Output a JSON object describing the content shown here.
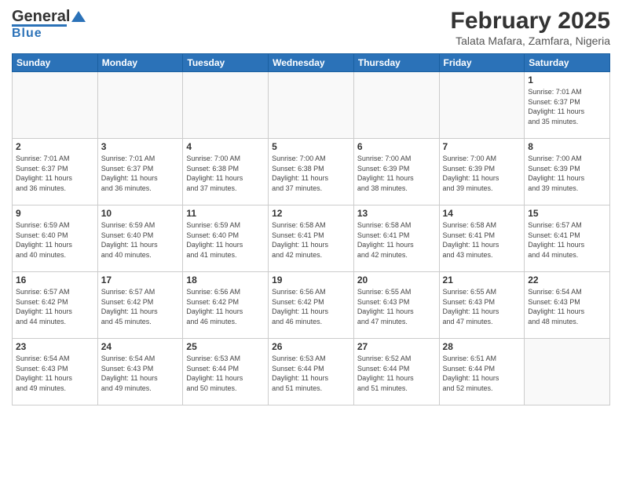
{
  "header": {
    "logo_general": "General",
    "logo_blue": "Blue",
    "month_title": "February 2025",
    "location": "Talata Mafara, Zamfara, Nigeria"
  },
  "days_of_week": [
    "Sunday",
    "Monday",
    "Tuesday",
    "Wednesday",
    "Thursday",
    "Friday",
    "Saturday"
  ],
  "weeks": [
    [
      {
        "day": "",
        "info": ""
      },
      {
        "day": "",
        "info": ""
      },
      {
        "day": "",
        "info": ""
      },
      {
        "day": "",
        "info": ""
      },
      {
        "day": "",
        "info": ""
      },
      {
        "day": "",
        "info": ""
      },
      {
        "day": "1",
        "info": "Sunrise: 7:01 AM\nSunset: 6:37 PM\nDaylight: 11 hours\nand 35 minutes."
      }
    ],
    [
      {
        "day": "2",
        "info": "Sunrise: 7:01 AM\nSunset: 6:37 PM\nDaylight: 11 hours\nand 36 minutes."
      },
      {
        "day": "3",
        "info": "Sunrise: 7:01 AM\nSunset: 6:37 PM\nDaylight: 11 hours\nand 36 minutes."
      },
      {
        "day": "4",
        "info": "Sunrise: 7:00 AM\nSunset: 6:38 PM\nDaylight: 11 hours\nand 37 minutes."
      },
      {
        "day": "5",
        "info": "Sunrise: 7:00 AM\nSunset: 6:38 PM\nDaylight: 11 hours\nand 37 minutes."
      },
      {
        "day": "6",
        "info": "Sunrise: 7:00 AM\nSunset: 6:39 PM\nDaylight: 11 hours\nand 38 minutes."
      },
      {
        "day": "7",
        "info": "Sunrise: 7:00 AM\nSunset: 6:39 PM\nDaylight: 11 hours\nand 39 minutes."
      },
      {
        "day": "8",
        "info": "Sunrise: 7:00 AM\nSunset: 6:39 PM\nDaylight: 11 hours\nand 39 minutes."
      }
    ],
    [
      {
        "day": "9",
        "info": "Sunrise: 6:59 AM\nSunset: 6:40 PM\nDaylight: 11 hours\nand 40 minutes."
      },
      {
        "day": "10",
        "info": "Sunrise: 6:59 AM\nSunset: 6:40 PM\nDaylight: 11 hours\nand 40 minutes."
      },
      {
        "day": "11",
        "info": "Sunrise: 6:59 AM\nSunset: 6:40 PM\nDaylight: 11 hours\nand 41 minutes."
      },
      {
        "day": "12",
        "info": "Sunrise: 6:58 AM\nSunset: 6:41 PM\nDaylight: 11 hours\nand 42 minutes."
      },
      {
        "day": "13",
        "info": "Sunrise: 6:58 AM\nSunset: 6:41 PM\nDaylight: 11 hours\nand 42 minutes."
      },
      {
        "day": "14",
        "info": "Sunrise: 6:58 AM\nSunset: 6:41 PM\nDaylight: 11 hours\nand 43 minutes."
      },
      {
        "day": "15",
        "info": "Sunrise: 6:57 AM\nSunset: 6:41 PM\nDaylight: 11 hours\nand 44 minutes."
      }
    ],
    [
      {
        "day": "16",
        "info": "Sunrise: 6:57 AM\nSunset: 6:42 PM\nDaylight: 11 hours\nand 44 minutes."
      },
      {
        "day": "17",
        "info": "Sunrise: 6:57 AM\nSunset: 6:42 PM\nDaylight: 11 hours\nand 45 minutes."
      },
      {
        "day": "18",
        "info": "Sunrise: 6:56 AM\nSunset: 6:42 PM\nDaylight: 11 hours\nand 46 minutes."
      },
      {
        "day": "19",
        "info": "Sunrise: 6:56 AM\nSunset: 6:42 PM\nDaylight: 11 hours\nand 46 minutes."
      },
      {
        "day": "20",
        "info": "Sunrise: 6:55 AM\nSunset: 6:43 PM\nDaylight: 11 hours\nand 47 minutes."
      },
      {
        "day": "21",
        "info": "Sunrise: 6:55 AM\nSunset: 6:43 PM\nDaylight: 11 hours\nand 47 minutes."
      },
      {
        "day": "22",
        "info": "Sunrise: 6:54 AM\nSunset: 6:43 PM\nDaylight: 11 hours\nand 48 minutes."
      }
    ],
    [
      {
        "day": "23",
        "info": "Sunrise: 6:54 AM\nSunset: 6:43 PM\nDaylight: 11 hours\nand 49 minutes."
      },
      {
        "day": "24",
        "info": "Sunrise: 6:54 AM\nSunset: 6:43 PM\nDaylight: 11 hours\nand 49 minutes."
      },
      {
        "day": "25",
        "info": "Sunrise: 6:53 AM\nSunset: 6:44 PM\nDaylight: 11 hours\nand 50 minutes."
      },
      {
        "day": "26",
        "info": "Sunrise: 6:53 AM\nSunset: 6:44 PM\nDaylight: 11 hours\nand 51 minutes."
      },
      {
        "day": "27",
        "info": "Sunrise: 6:52 AM\nSunset: 6:44 PM\nDaylight: 11 hours\nand 51 minutes."
      },
      {
        "day": "28",
        "info": "Sunrise: 6:51 AM\nSunset: 6:44 PM\nDaylight: 11 hours\nand 52 minutes."
      },
      {
        "day": "",
        "info": ""
      }
    ]
  ]
}
